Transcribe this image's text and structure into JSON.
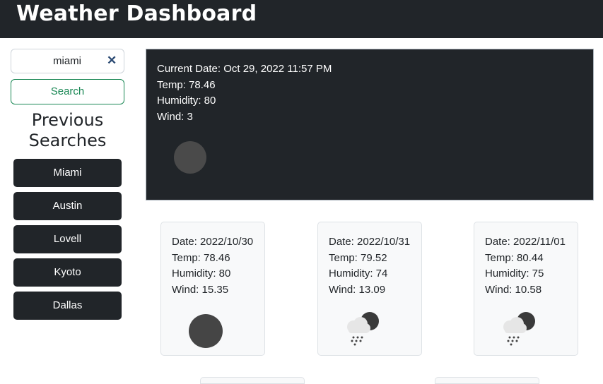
{
  "header": {
    "title": "Weather Dashboard"
  },
  "search": {
    "value": "miami",
    "button_label": "Search",
    "clear_icon": "close-icon"
  },
  "sidebar": {
    "title_line1": "Previous",
    "title_line2": "Searches",
    "history": [
      "Miami",
      "Austin",
      "Lovell",
      "Kyoto",
      "Dallas"
    ]
  },
  "current": {
    "date": "Current Date: Oct 29, 2022 11:57 PM",
    "temp": "Temp: 78.46",
    "humidity": "Humidity: 80",
    "wind": "Wind: 3",
    "icon": "night-clear-icon"
  },
  "forecast": [
    {
      "date": "Date: 2022/10/30",
      "temp": "Temp: 78.46",
      "humidity": "Humidity: 80",
      "wind": "Wind: 15.35",
      "icon": "night-clear-icon"
    },
    {
      "date": "Date: 2022/10/31",
      "temp": "Temp: 79.52",
      "humidity": "Humidity: 74",
      "wind": "Wind: 13.09",
      "icon": "night-rain-icon"
    },
    {
      "date": "Date: 2022/11/01",
      "temp": "Temp: 80.44",
      "humidity": "Humidity: 75",
      "wind": "Wind: 10.58",
      "icon": "night-rain-icon"
    }
  ],
  "colors": {
    "dark": "#212529",
    "accent_green": "#198754",
    "card_bg": "#f8f9fa"
  }
}
